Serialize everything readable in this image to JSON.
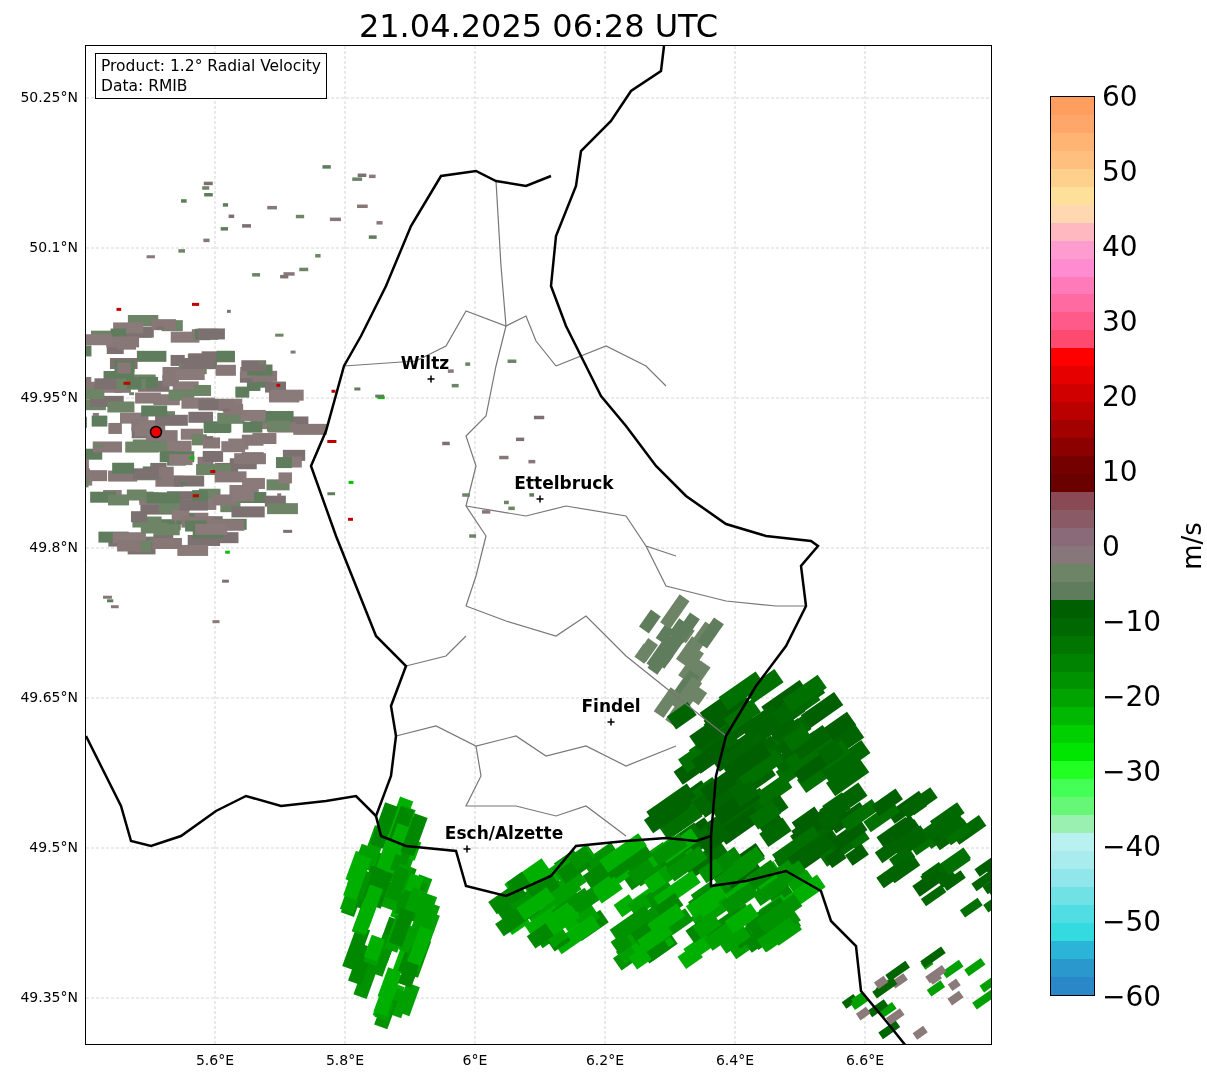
{
  "title": "21.04.2025 06:28 UTC",
  "legend": [
    "Product: 1.2° Radial Velocity",
    "Data: RMIB"
  ],
  "map": {
    "lat_ticks": [
      "50.25°N",
      "50.1°N",
      "49.95°N",
      "49.8°N",
      "49.65°N",
      "49.5°N",
      "49.35°N"
    ],
    "lon_ticks": [
      "5.6°E",
      "5.8°E",
      "6°E",
      "6.2°E",
      "6.4°E",
      "6.6°E"
    ],
    "cities": [
      {
        "name": "Wiltz"
      },
      {
        "name": "Ettelbruck"
      },
      {
        "name": "Findel"
      },
      {
        "name": "Esch/Alzette"
      }
    ]
  },
  "colorbar": {
    "label": "m/s",
    "ticks": [
      "60",
      "50",
      "40",
      "30",
      "20",
      "10",
      "0",
      "−10",
      "−20",
      "−30",
      "−40",
      "−50",
      "−60"
    ]
  }
}
